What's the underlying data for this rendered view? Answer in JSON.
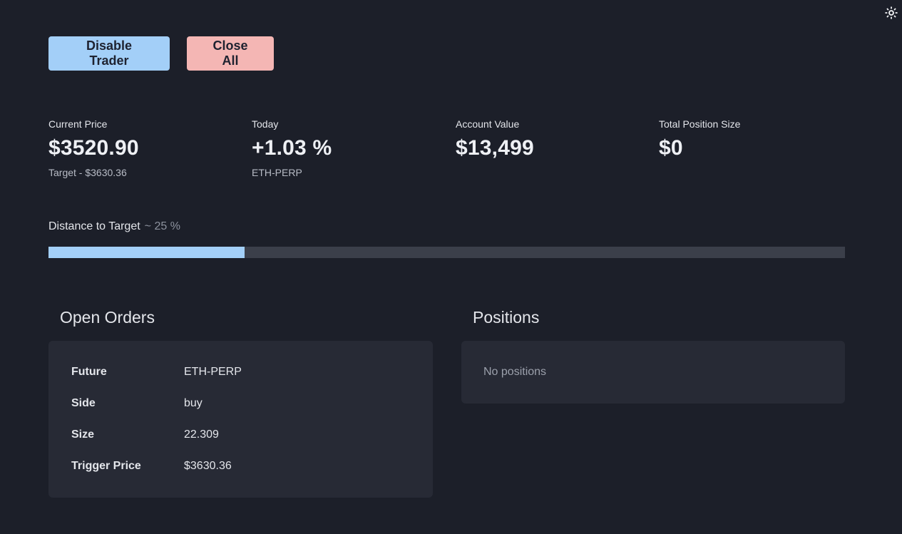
{
  "actions": {
    "disable_label": "Disable Trader",
    "close_label": "Close All"
  },
  "stats": [
    {
      "label": "Current Price",
      "value": "$3520.90",
      "sub": "Target - $3630.36"
    },
    {
      "label": "Today",
      "value": "+1.03 %",
      "sub": "ETH-PERP"
    },
    {
      "label": "Account Value",
      "value": "$13,499",
      "sub": ""
    },
    {
      "label": "Total Position Size",
      "value": "$0",
      "sub": ""
    }
  ],
  "progress": {
    "title": "Distance to Target",
    "hint": "~ 25 %",
    "fraction": 0.246
  },
  "orders": {
    "title": "Open Orders",
    "rows": [
      {
        "key": "Future",
        "value": "ETH-PERP"
      },
      {
        "key": "Side",
        "value": "buy"
      },
      {
        "key": "Size",
        "value": "22.309"
      },
      {
        "key": "Trigger Price",
        "value": "$3630.36"
      }
    ]
  },
  "positions": {
    "title": "Positions",
    "empty_text": "No positions"
  },
  "icons": {
    "theme_toggle": "sun-icon"
  },
  "colors": {
    "background": "#1c1f29",
    "card": "#272a35",
    "accent_blue": "#a3cff8",
    "accent_red": "#f4b6b4",
    "track": "#3b3f4a"
  }
}
